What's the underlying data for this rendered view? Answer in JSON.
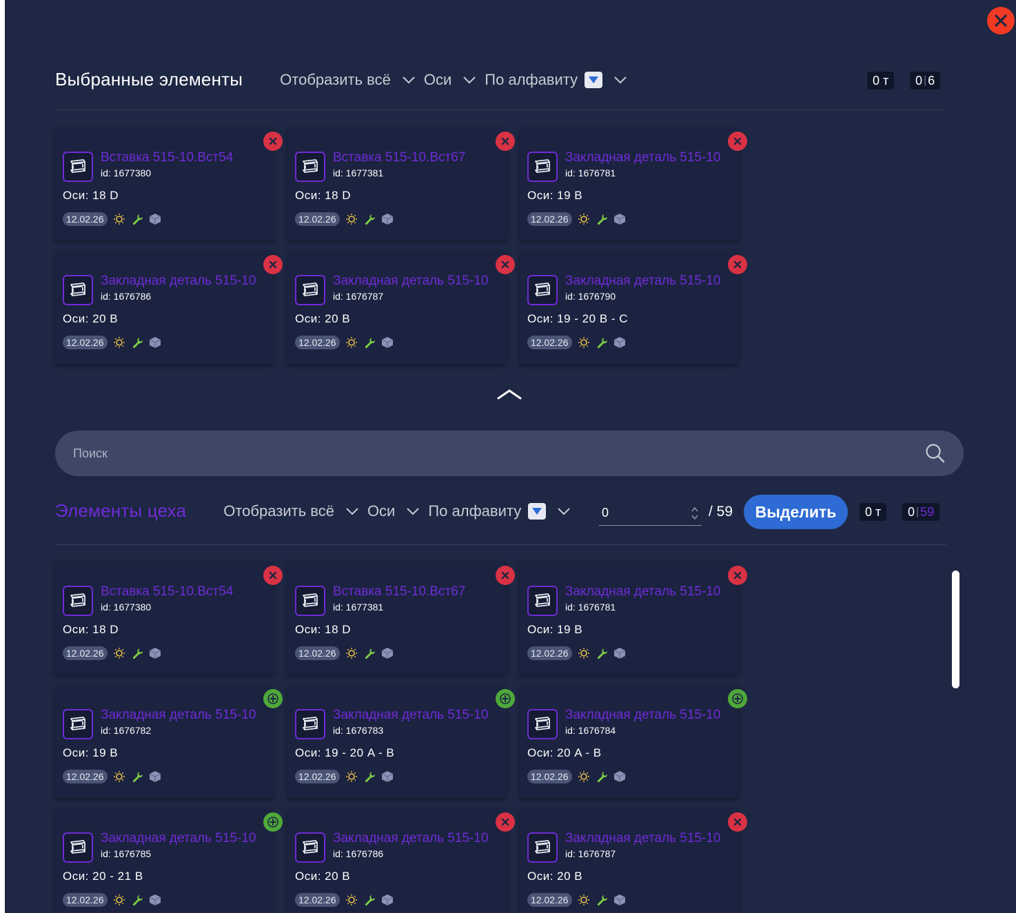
{
  "colors": {
    "background": "#1e2743",
    "accent": "#6f2bd6",
    "button": "#2f6bd4",
    "remove": "#d93244",
    "add": "#4ea83a"
  },
  "selected": {
    "title": "Выбранные элементы",
    "filter_show": "Отобразить всё",
    "filter_axes": "Оси",
    "filter_sort": "По алфавиту",
    "weight": "0 т",
    "count_a": "0",
    "count_b": "6",
    "cards": [
      {
        "name": "Вставка 515-10.Вст54",
        "id": "id: 1677380",
        "axes": "Оси: 18 D",
        "date": "12.02.26",
        "action": "remove"
      },
      {
        "name": "Вставка 515-10.Вст67",
        "id": "id: 1677381",
        "axes": "Оси: 18 D",
        "date": "12.02.26",
        "action": "remove"
      },
      {
        "name": "Закладная деталь 515-10",
        "id": "id: 1676781",
        "axes": "Оси: 19 B",
        "date": "12.02.26",
        "action": "remove"
      },
      {
        "name": "Закладная деталь 515-10",
        "id": "id: 1676786",
        "axes": "Оси: 20 B",
        "date": "12.02.26",
        "action": "remove"
      },
      {
        "name": "Закладная деталь 515-10",
        "id": "id: 1676787",
        "axes": "Оси: 20 B",
        "date": "12.02.26",
        "action": "remove"
      },
      {
        "name": "Закладная деталь 515-10",
        "id": "id: 1676790",
        "axes": "Оси: 19 - 20 B - C",
        "date": "12.02.26",
        "action": "remove"
      }
    ]
  },
  "search": {
    "placeholder": "Поиск"
  },
  "workshop": {
    "title": "Элементы цеха",
    "filter_show": "Отобразить всё",
    "filter_axes": "Оси",
    "filter_sort": "По алфавиту",
    "qty_value": "0",
    "qty_total": "/ 59",
    "select_label": "Выделить",
    "weight": "0 т",
    "count_a": "0",
    "count_b": "59",
    "cards": [
      {
        "name": "Вставка 515-10.Вст54",
        "id": "id: 1677380",
        "axes": "Оси: 18 D",
        "date": "12.02.26",
        "action": "remove"
      },
      {
        "name": "Вставка 515-10.Вст67",
        "id": "id: 1677381",
        "axes": "Оси: 18 D",
        "date": "12.02.26",
        "action": "remove"
      },
      {
        "name": "Закладная деталь 515-10",
        "id": "id: 1676781",
        "axes": "Оси: 19 B",
        "date": "12.02.26",
        "action": "remove"
      },
      {
        "name": "Закладная деталь 515-10",
        "id": "id: 1676782",
        "axes": "Оси: 19 B",
        "date": "12.02.26",
        "action": "add"
      },
      {
        "name": "Закладная деталь 515-10",
        "id": "id: 1676783",
        "axes": "Оси: 19 - 20 A - B",
        "date": "12.02.26",
        "action": "add"
      },
      {
        "name": "Закладная деталь 515-10",
        "id": "id: 1676784",
        "axes": "Оси: 20 A - B",
        "date": "12.02.26",
        "action": "add"
      },
      {
        "name": "Закладная деталь 515-10",
        "id": "id: 1676785",
        "axes": "Оси: 20 - 21 B",
        "date": "12.02.26",
        "action": "add"
      },
      {
        "name": "Закладная деталь 515-10",
        "id": "id: 1676786",
        "axes": "Оси: 20 B",
        "date": "12.02.26",
        "action": "remove"
      },
      {
        "name": "Закладная деталь 515-10",
        "id": "id: 1676787",
        "axes": "Оси: 20 B",
        "date": "12.02.26",
        "action": "remove"
      }
    ]
  }
}
